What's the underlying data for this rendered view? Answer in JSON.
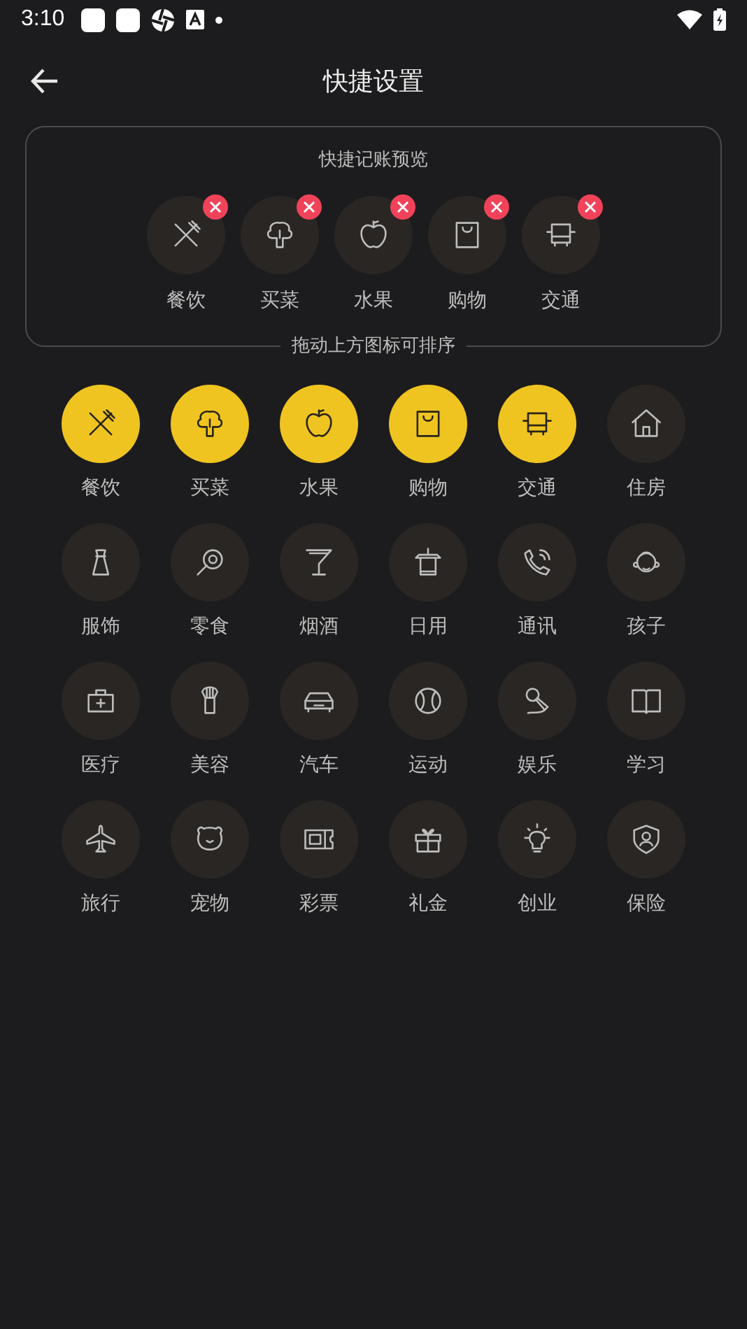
{
  "status_bar": {
    "time": "3:10"
  },
  "header": {
    "title": "快捷设置"
  },
  "preview": {
    "title": "快捷记账预览",
    "items": [
      {
        "label": "餐饮"
      },
      {
        "label": "买菜"
      },
      {
        "label": "水果"
      },
      {
        "label": "购物"
      },
      {
        "label": "交通"
      }
    ],
    "hint": "拖动上方图标可排序"
  },
  "categories": [
    {
      "label": "餐饮",
      "selected": true
    },
    {
      "label": "买菜",
      "selected": true
    },
    {
      "label": "水果",
      "selected": true
    },
    {
      "label": "购物",
      "selected": true
    },
    {
      "label": "交通",
      "selected": true
    },
    {
      "label": "住房",
      "selected": false
    },
    {
      "label": "服饰",
      "selected": false
    },
    {
      "label": "零食",
      "selected": false
    },
    {
      "label": "烟酒",
      "selected": false
    },
    {
      "label": "日用",
      "selected": false
    },
    {
      "label": "通讯",
      "selected": false
    },
    {
      "label": "孩子",
      "selected": false
    },
    {
      "label": "医疗",
      "selected": false
    },
    {
      "label": "美容",
      "selected": false
    },
    {
      "label": "汽车",
      "selected": false
    },
    {
      "label": "运动",
      "selected": false
    },
    {
      "label": "娱乐",
      "selected": false
    },
    {
      "label": "学习",
      "selected": false
    },
    {
      "label": "旅行",
      "selected": false
    },
    {
      "label": "宠物",
      "selected": false
    },
    {
      "label": "彩票",
      "selected": false
    },
    {
      "label": "礼金",
      "selected": false
    },
    {
      "label": "创业",
      "selected": false
    },
    {
      "label": "保险",
      "selected": false
    }
  ]
}
